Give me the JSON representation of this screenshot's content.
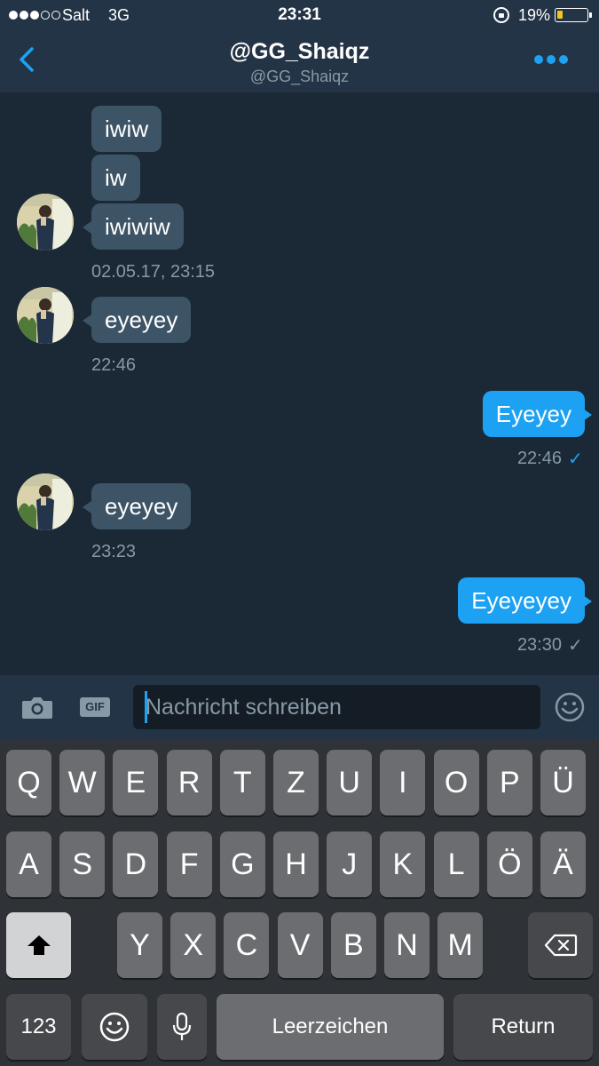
{
  "status_bar": {
    "carrier": "Salt",
    "network": "3G",
    "time": "23:31",
    "battery_percent": "19%",
    "battery_level": 0.19,
    "signal_bars": 3
  },
  "header": {
    "title": "@GG_Shaiqz",
    "subtitle": "@GG_Shaiqz"
  },
  "messages": [
    {
      "text": "iwiw",
      "direction": "incoming"
    },
    {
      "text": "iw",
      "direction": "incoming"
    },
    {
      "text": "iwiwiw",
      "direction": "incoming",
      "timestamp": "02.05.17, 23:15"
    },
    {
      "text": "eyeyey",
      "direction": "incoming",
      "timestamp": "22:46"
    },
    {
      "text": "Eyeyey",
      "direction": "outgoing",
      "timestamp": "22:46",
      "status": "read"
    },
    {
      "text": "eyeyey",
      "direction": "incoming",
      "timestamp": "23:23"
    },
    {
      "text": "Eyeyeyey",
      "direction": "outgoing",
      "timestamp": "23:30",
      "status": "sent"
    }
  ],
  "composer": {
    "placeholder": "Nachricht schreiben",
    "gif_label": "GIF"
  },
  "keyboard": {
    "row1": [
      "Q",
      "W",
      "E",
      "R",
      "T",
      "Z",
      "U",
      "I",
      "O",
      "P",
      "Ü"
    ],
    "row2": [
      "A",
      "S",
      "D",
      "F",
      "G",
      "H",
      "J",
      "K",
      "L",
      "Ö",
      "Ä"
    ],
    "row3": [
      "Y",
      "X",
      "C",
      "V",
      "B",
      "N",
      "M"
    ],
    "numbers_label": "123",
    "space_label": "Leerzeichen",
    "return_label": "Return"
  },
  "colors": {
    "accent": "#1da1f2",
    "background": "#1b2836",
    "bar": "#243447",
    "incoming_bubble": "#3d5466",
    "muted_text": "#8899a6",
    "battery": "#f5c518"
  }
}
